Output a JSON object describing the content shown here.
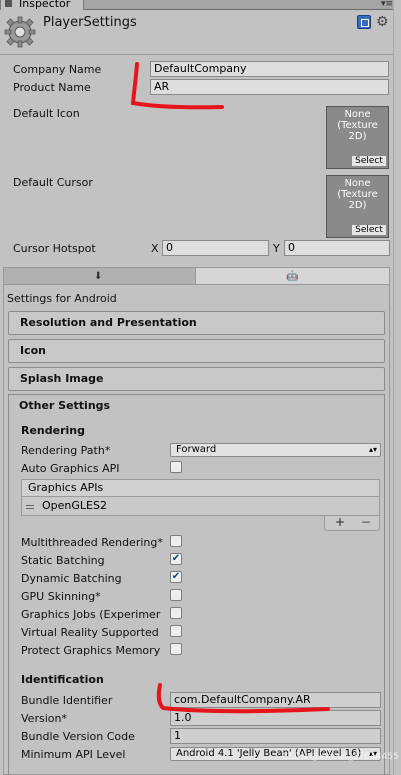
{
  "tab": {
    "label": "Inspector"
  },
  "header": {
    "title": "PlayerSettings"
  },
  "company": {
    "label": "Company Name",
    "value": "DefaultCompany"
  },
  "product": {
    "label": "Product Name",
    "value": "AR"
  },
  "default_icon": {
    "label": "Default Icon",
    "slot_text": "None\n(Texture\n2D)",
    "select": "Select"
  },
  "default_cursor": {
    "label": "Default Cursor",
    "slot_text": "None\n(Texture\n2D)",
    "select": "Select"
  },
  "hotspot": {
    "label": "Cursor Hotspot",
    "x_label": "X",
    "x_value": "0",
    "y_label": "Y",
    "y_value": "0"
  },
  "platform": {
    "settings_for": "Settings for Android"
  },
  "sections": {
    "resolution": "Resolution and Presentation",
    "icon": "Icon",
    "splash": "Splash Image",
    "other": "Other Settings"
  },
  "rendering": {
    "title": "Rendering",
    "path_label": "Rendering Path*",
    "path_value": "Forward",
    "auto_graphics_label": "Auto Graphics API",
    "graphics_apis_header": "Graphics APIs",
    "graphics_api_item": "OpenGLES2",
    "list_add": "+",
    "list_remove": "−",
    "multithreaded": "Multithreaded Rendering*",
    "static_batching": "Static Batching",
    "dynamic_batching": "Dynamic Batching",
    "gpu_skinning": "GPU Skinning*",
    "graphics_jobs": "Graphics Jobs (Experimer",
    "vr_supported": "Virtual Reality Supported",
    "protect_memory": "Protect Graphics Memory"
  },
  "identification": {
    "title": "Identification",
    "bundle_label": "Bundle Identifier",
    "bundle_value": "com.DefaultCompany.AR",
    "version_label": "Version*",
    "version_value": "1.0",
    "code_label": "Bundle Version Code",
    "code_value": "1",
    "min_api_label": "Minimum API Level",
    "min_api_value": "Android 4.1 'Jelly Bean' (API level 16)"
  },
  "checks": {
    "checked_mark": "✔"
  },
  "watermark": "CSDN @weixin_37044455",
  "colors": {
    "annotation": "#e8141b",
    "accent": "#3b6dbf",
    "background": "#c2c2c2"
  }
}
